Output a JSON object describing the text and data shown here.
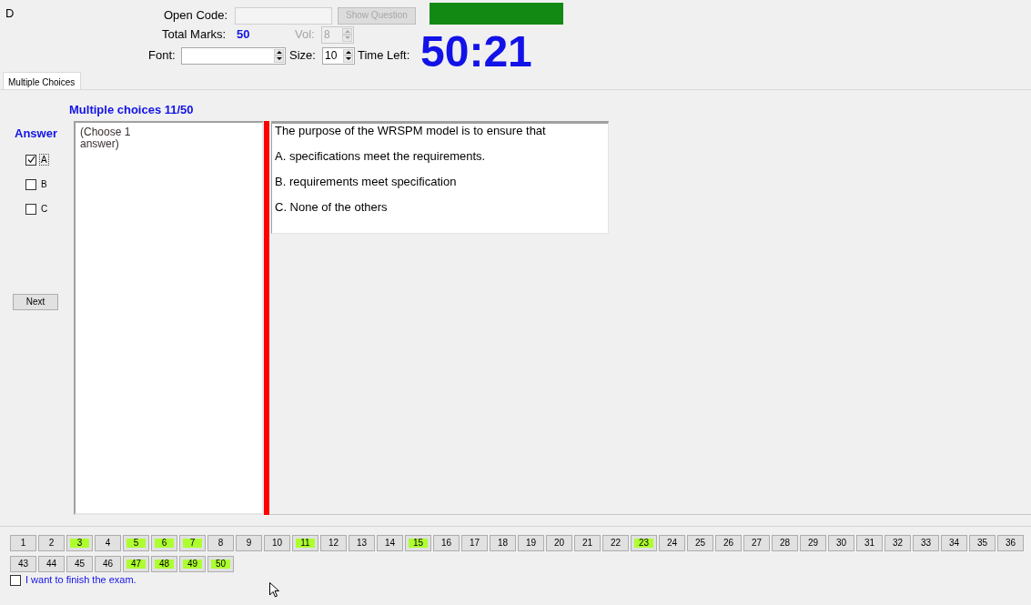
{
  "header": {
    "label_fragment": "D",
    "open_code": {
      "label": "Open Code:"
    },
    "show_question": {
      "label": "Show Question",
      "disabled": true
    },
    "total_marks": {
      "label": "Total Marks:",
      "value": "50"
    },
    "vol": {
      "label": "Vol:",
      "value": "8",
      "disabled": true
    },
    "font": {
      "label": "Font:"
    },
    "size": {
      "label": "Size:",
      "value": "10"
    },
    "time_left": {
      "label": "Time Left:",
      "value": "50:21"
    }
  },
  "tabs": [
    {
      "label": "Multiple Choices",
      "selected": true
    }
  ],
  "question_heading": "Multiple choices 11/50",
  "answer_panel": {
    "title": "Answer",
    "options": [
      {
        "label": "A",
        "checked": true,
        "focused": true
      },
      {
        "label": "B",
        "checked": false,
        "focused": false
      },
      {
        "label": "C",
        "checked": false,
        "focused": false
      }
    ],
    "next_button": "Next"
  },
  "instruction": "(Choose 1 answer)",
  "question": {
    "stem": "The purpose of the WRSPM model is to ensure that",
    "choices": [
      "A. specifications meet the requirements.",
      "B. requirements meet specification",
      "C. None of the others"
    ]
  },
  "question_nav": {
    "rows": [
      {
        "buttons": [
          {
            "number": "1",
            "answered": false
          },
          {
            "number": "2",
            "answered": false
          },
          {
            "number": "3",
            "answered": true
          },
          {
            "number": "4",
            "answered": false
          },
          {
            "number": "5",
            "answered": true
          },
          {
            "number": "6",
            "answered": true
          },
          {
            "number": "7",
            "answered": true
          },
          {
            "number": "8",
            "answered": false
          },
          {
            "number": "9",
            "answered": false
          },
          {
            "number": "10",
            "answered": false
          },
          {
            "number": "11",
            "answered": true
          },
          {
            "number": "12",
            "answered": false
          },
          {
            "number": "13",
            "answered": false
          },
          {
            "number": "14",
            "answered": false
          },
          {
            "number": "15",
            "answered": true
          },
          {
            "number": "16",
            "answered": false
          },
          {
            "number": "17",
            "answered": false
          },
          {
            "number": "18",
            "answered": false
          },
          {
            "number": "19",
            "answered": false
          },
          {
            "number": "20",
            "answered": false
          },
          {
            "number": "21",
            "answered": false
          },
          {
            "number": "22",
            "answered": false
          },
          {
            "number": "23",
            "answered": true
          },
          {
            "number": "24",
            "answered": false
          },
          {
            "number": "25",
            "answered": false
          },
          {
            "number": "26",
            "answered": false
          },
          {
            "number": "27",
            "answered": false
          },
          {
            "number": "28",
            "answered": false
          },
          {
            "number": "29",
            "answered": false
          },
          {
            "number": "30",
            "answered": false
          },
          {
            "number": "31",
            "answered": false
          },
          {
            "number": "32",
            "answered": false
          },
          {
            "number": "33",
            "answered": false
          },
          {
            "number": "34",
            "answered": false
          },
          {
            "number": "35",
            "answered": false
          },
          {
            "number": "36",
            "answered": false
          }
        ]
      },
      {
        "buttons": [
          {
            "number": "43",
            "answered": false
          },
          {
            "number": "44",
            "answered": false
          },
          {
            "number": "45",
            "answered": false
          },
          {
            "number": "46",
            "answered": false
          },
          {
            "number": "47",
            "answered": true
          },
          {
            "number": "48",
            "answered": true
          },
          {
            "number": "49",
            "answered": true
          },
          {
            "number": "50",
            "answered": true
          }
        ]
      }
    ]
  },
  "finish": {
    "label": "I want to finish the exam.",
    "checked": false
  }
}
